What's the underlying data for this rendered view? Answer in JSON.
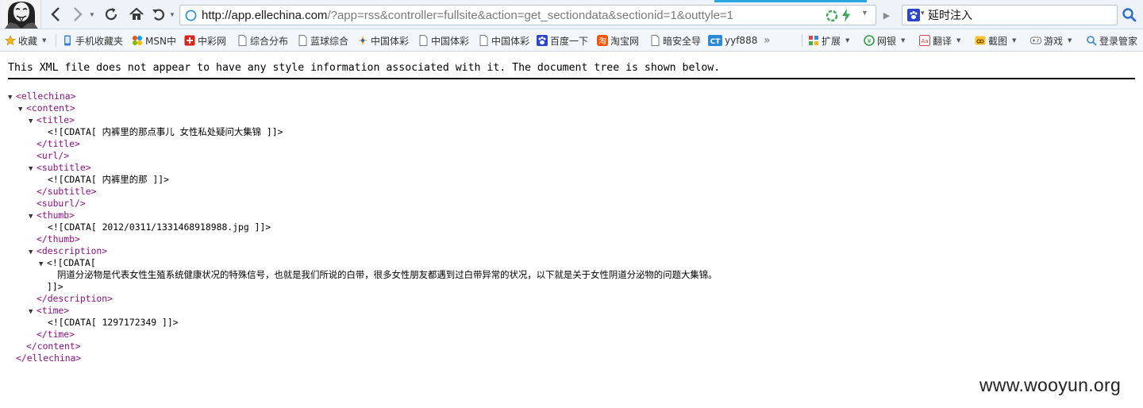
{
  "address": {
    "host": "http://app.ellechina.com",
    "path": "/?app=rss&controller=fullsite&action=get_sectiondata&sectionid=1&outtyle=1"
  },
  "search": {
    "value": "延时注入"
  },
  "bookmarks": {
    "favorites": "收藏",
    "mobile": "手机收藏夹",
    "msn": "MSN中",
    "zhongcai": "中彩网",
    "zonghe": "综合分布",
    "lanqiu": "蓝球综合",
    "ticai1": "中国体彩",
    "ticai2": "中国体彩",
    "ticai3": "中国体彩",
    "baidu": "百度一下",
    "taobao": "淘宝网",
    "anquan": "暗安全导",
    "yyf": "yyf888",
    "more": "»",
    "ext": "扩展",
    "bank": "网银",
    "translate": "翻译",
    "screenshot": "截图",
    "games": "游戏",
    "login": "登录管家"
  },
  "colors": {
    "tag": "#881280",
    "accent": "#29a8e0"
  },
  "xml": {
    "notice": "This XML file does not appear to have any style information associated with it. The document tree is shown below.",
    "lines": {
      "ellechina_open": "<ellechina>",
      "content_open": "<content>",
      "title_open": "<title>",
      "title_cdata": "<![CDATA[ 内裤里的那点事儿 女性私处疑问大集锦 ]]>",
      "title_close": "</title>",
      "url_empty": "<url/>",
      "subtitle_open": "<subtitle>",
      "subtitle_cdata": "<![CDATA[ 内裤里的那 ]]>",
      "subtitle_close": "</subtitle>",
      "suburl_empty": "<suburl/>",
      "thumb_open": "<thumb>",
      "thumb_cdata": "<![CDATA[ 2012/0311/1331468918988.jpg ]]>",
      "thumb_close": "</thumb>",
      "description_open": "<description>",
      "description_cdata_open": "<![CDATA[",
      "description_text": "阴道分泌物是代表女性生殖系统健康状况的特殊信号，也就是我们所说的白带，很多女性朋友都遇到过白带异常的状况，以下就是关于女性阴道分泌物的问题大集锦。",
      "description_cdata_close": "]]>",
      "description_close": "</description>",
      "time_open": "<time>",
      "time_cdata": "<![CDATA[ 1297172349 ]]>",
      "time_close": "</time>",
      "content_close": "</content>",
      "ellechina_close": "</ellechina>"
    }
  },
  "watermark": "www.wooyun.org"
}
